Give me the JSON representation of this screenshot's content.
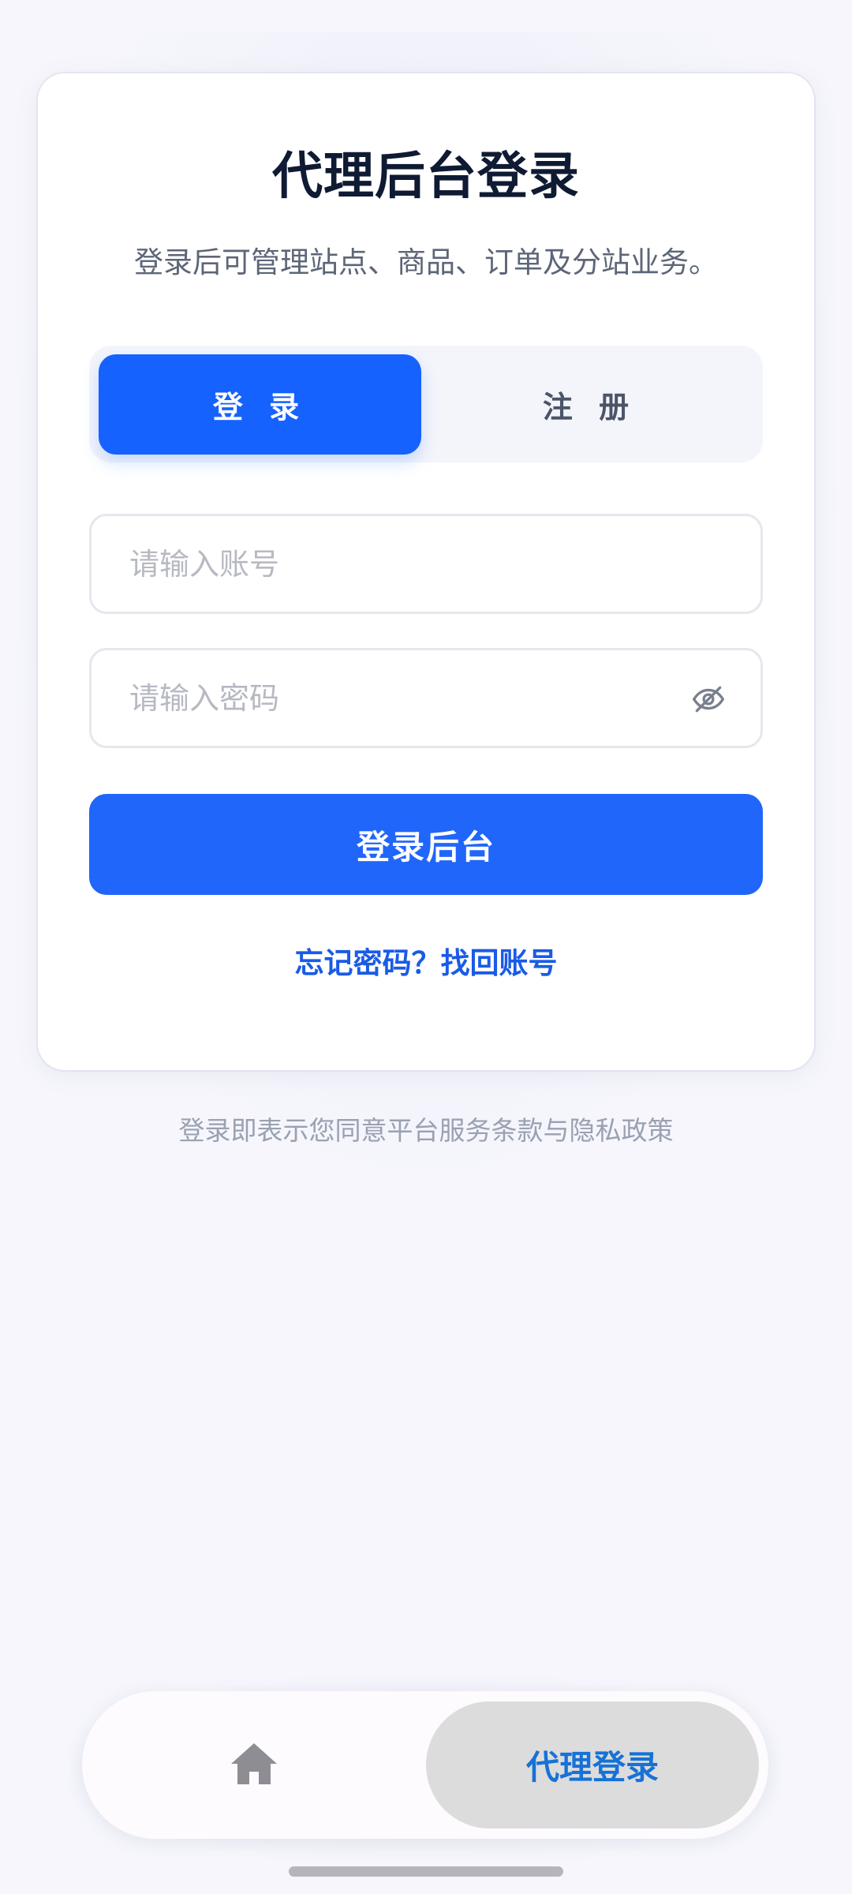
{
  "login_card": {
    "title": "代理后台登录",
    "subtitle": "登录后可管理站点、商品、订单及分站业务。",
    "tabs": {
      "login": "登 录",
      "register": "注 册",
      "active": "login"
    },
    "account_field": {
      "placeholder": "请输入账号",
      "value": ""
    },
    "password_field": {
      "placeholder": "请输入密码",
      "value": "",
      "toggle_icon": "eye-off-icon"
    },
    "submit_label": "登录后台",
    "forgot_link": "忘记密码？找回账号"
  },
  "terms_text": "登录即表示您同意平台服务条款与隐私政策",
  "bottom_nav": {
    "home_icon": "home-icon",
    "active_label": "代理登录"
  },
  "colors": {
    "primary": "#1662ff",
    "submit": "#2166fa",
    "link": "#1a5be6",
    "nav_active_text": "#1672d6",
    "background": "#f6f6fc"
  }
}
